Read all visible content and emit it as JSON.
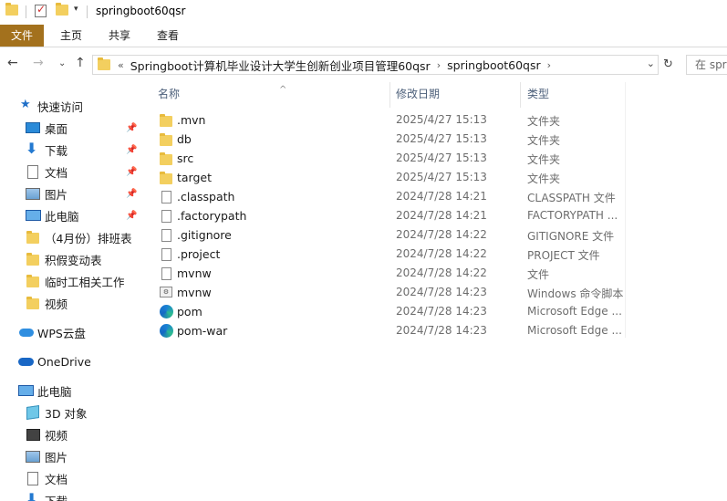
{
  "window": {
    "title": "springboot60qsr"
  },
  "ribbon": {
    "tabs": [
      "文件",
      "主页",
      "共享",
      "查看"
    ]
  },
  "address": {
    "prefix": "«",
    "crumbs": [
      "Springboot计算机毕业设计大学生创新创业项目管理60qsr",
      "springboot60qsr"
    ],
    "search_placeholder": "在 spr"
  },
  "sidebar": {
    "quick_access": "快速访问",
    "items": [
      {
        "label": "桌面",
        "icon": "desktop-icon",
        "pinned": true
      },
      {
        "label": "下载",
        "icon": "download-icon",
        "pinned": true
      },
      {
        "label": "文档",
        "icon": "document-icon",
        "pinned": true
      },
      {
        "label": "图片",
        "icon": "pictures-icon",
        "pinned": true
      },
      {
        "label": "此电脑",
        "icon": "computer-icon",
        "pinned": true
      },
      {
        "label": "（4月份）排班表",
        "icon": "folder-icon",
        "pinned": false
      },
      {
        "label": "积假变动表",
        "icon": "folder-icon",
        "pinned": false
      },
      {
        "label": "临时工相关工作",
        "icon": "folder-icon",
        "pinned": false
      },
      {
        "label": "视频",
        "icon": "folder-icon",
        "pinned": false
      }
    ],
    "wps": "WPS云盘",
    "onedrive": "OneDrive",
    "this_pc": "此电脑",
    "pc_items": [
      {
        "label": "3D 对象",
        "icon": "3d-objects-icon"
      },
      {
        "label": "视频",
        "icon": "video-icon"
      },
      {
        "label": "图片",
        "icon": "pictures-icon"
      },
      {
        "label": "文档",
        "icon": "document-icon"
      },
      {
        "label": "下载",
        "icon": "download-icon"
      }
    ]
  },
  "columns": {
    "name": "名称",
    "date": "修改日期",
    "type": "类型"
  },
  "files": [
    {
      "name": ".mvn",
      "date": "2025/4/27 15:13",
      "type": "文件夹",
      "icon": "folder-icon"
    },
    {
      "name": "db",
      "date": "2025/4/27 15:13",
      "type": "文件夹",
      "icon": "folder-icon"
    },
    {
      "name": "src",
      "date": "2025/4/27 15:13",
      "type": "文件夹",
      "icon": "folder-icon"
    },
    {
      "name": "target",
      "date": "2025/4/27 15:13",
      "type": "文件夹",
      "icon": "folder-icon"
    },
    {
      "name": ".classpath",
      "date": "2024/7/28 14:21",
      "type": "CLASSPATH 文件",
      "icon": "file-icon"
    },
    {
      "name": ".factorypath",
      "date": "2024/7/28 14:21",
      "type": "FACTORYPATH ...",
      "icon": "file-icon"
    },
    {
      "name": ".gitignore",
      "date": "2024/7/28 14:22",
      "type": "GITIGNORE 文件",
      "icon": "file-icon"
    },
    {
      "name": ".project",
      "date": "2024/7/28 14:22",
      "type": "PROJECT 文件",
      "icon": "file-icon"
    },
    {
      "name": "mvnw",
      "date": "2024/7/28 14:22",
      "type": "文件",
      "icon": "file-icon"
    },
    {
      "name": "mvnw",
      "date": "2024/7/28 14:23",
      "type": "Windows 命令脚本",
      "icon": "cmd-script-icon"
    },
    {
      "name": "pom",
      "date": "2024/7/28 14:23",
      "type": "Microsoft Edge ...",
      "icon": "edge-icon"
    },
    {
      "name": "pom-war",
      "date": "2024/7/28 14:23",
      "type": "Microsoft Edge ...",
      "icon": "edge-icon"
    }
  ],
  "colors": {
    "file_tab": "#a3711d",
    "folder": "#f3cf5f",
    "accent": "#1f6fc8"
  }
}
